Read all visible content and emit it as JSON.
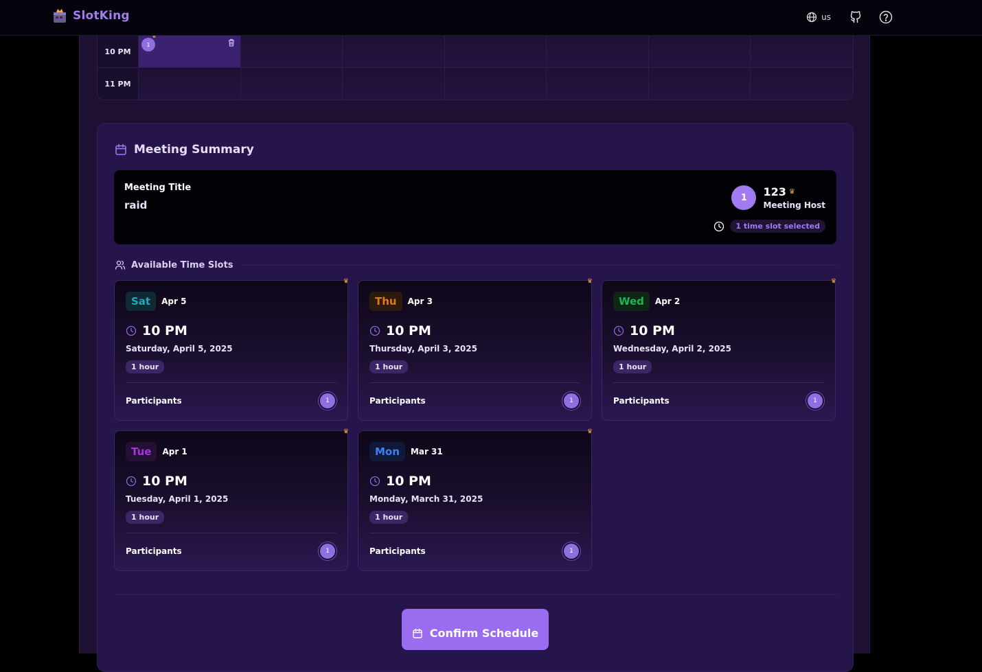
{
  "brand": {
    "name": "SlotKing"
  },
  "topbar": {
    "language": "us"
  },
  "grid": {
    "rows": [
      {
        "time": "10 PM",
        "selected_avatar": "1"
      },
      {
        "time": "11 PM"
      }
    ]
  },
  "summary": {
    "title": "Meeting Summary",
    "meeting_title_label": "Meeting Title",
    "meeting_title_value": "raid",
    "host": {
      "avatar": "1",
      "name": "123",
      "role": "Meeting Host"
    },
    "selected_text": "1 time slot selected",
    "available_title": "Available Time Slots",
    "slots": [
      {
        "day": "Sat",
        "date": "Apr 5",
        "time": "10 PM",
        "full_date": "Saturday, April 5, 2025",
        "duration": "1 hour",
        "participants_label": "Participants",
        "participant": "1",
        "day_color": "#22a7c2",
        "day_bg": "#0f2a33"
      },
      {
        "day": "Thu",
        "date": "Apr 3",
        "time": "10 PM",
        "full_date": "Thursday, April 3, 2025",
        "duration": "1 hour",
        "participants_label": "Participants",
        "participant": "1",
        "day_color": "#e07a18",
        "day_bg": "#2e1a0c"
      },
      {
        "day": "Wed",
        "date": "Apr 2",
        "time": "10 PM",
        "full_date": "Wednesday, April 2, 2025",
        "duration": "1 hour",
        "participants_label": "Participants",
        "participant": "1",
        "day_color": "#1fb455",
        "day_bg": "#0d2616"
      },
      {
        "day": "Tue",
        "date": "Apr 1",
        "time": "10 PM",
        "full_date": "Tuesday, April 1, 2025",
        "duration": "1 hour",
        "participants_label": "Participants",
        "participant": "1",
        "day_color": "#a834e0",
        "day_bg": "#241033"
      },
      {
        "day": "Mon",
        "date": "Mar 31",
        "time": "10 PM",
        "full_date": "Monday, March 31, 2025",
        "duration": "1 hour",
        "participants_label": "Participants",
        "participant": "1",
        "day_color": "#3f7ff0",
        "day_bg": "#101a38"
      }
    ],
    "confirm_label": "Confirm Schedule"
  },
  "colors": {
    "accent": "#9a6cf0",
    "crown": "#f2a93b",
    "panel": "#26154a"
  }
}
